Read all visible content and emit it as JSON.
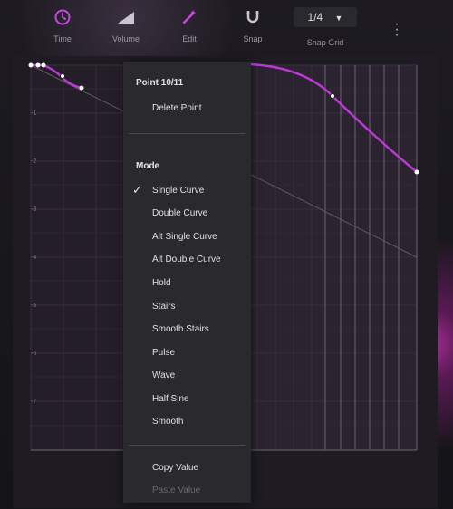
{
  "toolbar": {
    "time_label": "Time",
    "volume_label": "Volume",
    "edit_label": "Edit",
    "snap_label": "Snap",
    "snap_grid_value": "1/4",
    "snap_grid_label": "Snap Grid"
  },
  "y_axis": {
    "labels": [
      "-1",
      "-2",
      "-3",
      "-4",
      "-5",
      "-6",
      "-7"
    ]
  },
  "context_menu": {
    "point_header": "Point 10/11",
    "delete_point": "Delete Point",
    "mode_header": "Mode",
    "modes": [
      "Single Curve",
      "Double Curve",
      "Alt Single Curve",
      "Alt Double Curve",
      "Hold",
      "Stairs",
      "Smooth Stairs",
      "Pulse",
      "Wave",
      "Half Sine",
      "Smooth"
    ],
    "selected_mode": "Single Curve",
    "copy_value": "Copy Value",
    "paste_value": "Paste Value"
  },
  "colors": {
    "accent": "#c24bd8",
    "curve": "#b93ad2"
  }
}
